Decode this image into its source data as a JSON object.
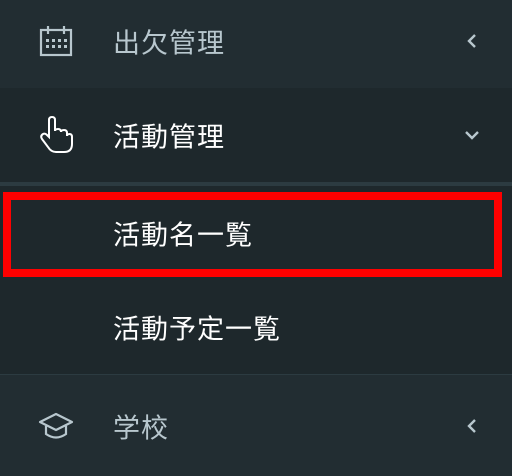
{
  "sidebar": {
    "items": [
      {
        "label": "出欠管理",
        "icon": "calendar-icon",
        "chevron": "chevron-left-icon"
      },
      {
        "label": "活動管理",
        "icon": "hand-pointer-icon",
        "chevron": "chevron-down-icon"
      },
      {
        "label": "学校",
        "icon": "graduation-cap-icon",
        "chevron": "chevron-left-icon"
      }
    ],
    "submenu": [
      {
        "label": "活動名一覧"
      },
      {
        "label": "活動予定一覧"
      }
    ]
  },
  "colors": {
    "sidebar_bg": "#222d32",
    "active_bg": "#1e282c",
    "text_muted": "#b8c7ce",
    "text_active": "#ffffff",
    "highlight": "#ff0000"
  }
}
